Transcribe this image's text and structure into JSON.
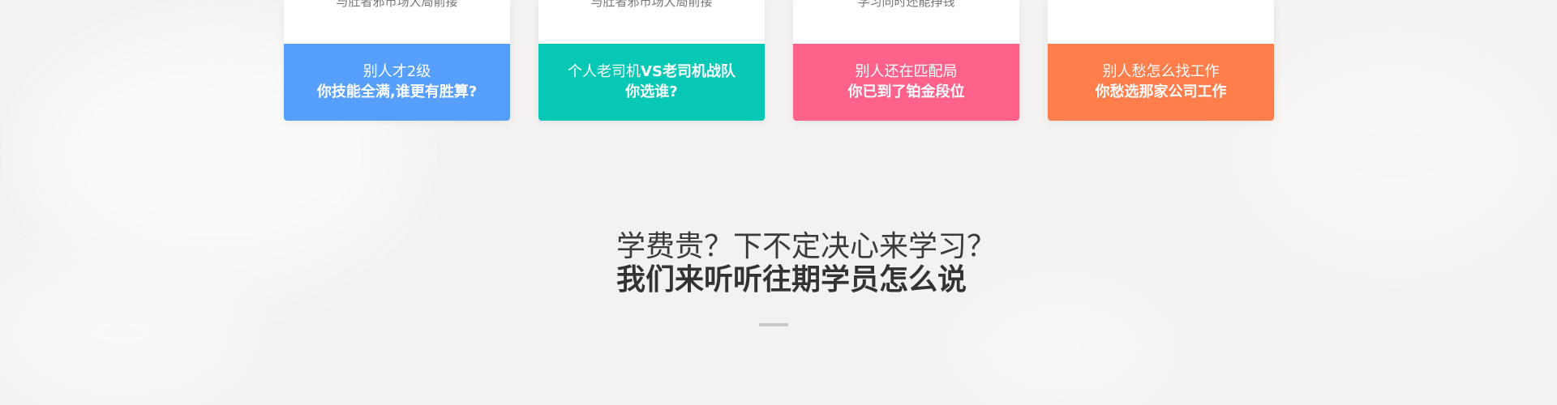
{
  "cards": [
    {
      "top_text": "与肚者邪市场大局前接",
      "line1": "别人才2级",
      "line2": "你技能全满,谁更有胜算?",
      "color": "#579ffd"
    },
    {
      "top_text": "与肚者邪市场大局前接",
      "line1_a": "个人老司机",
      "line1_b": "VS老司机战队",
      "line2": "你选谁?",
      "color": "#06c8b4"
    },
    {
      "top_text": "学习同时还能挣钱",
      "line1": "别人还在匹配局",
      "line2": "你已到了铂金段位",
      "color": "#fe6189"
    },
    {
      "top_text": "",
      "line1": "别人愁怎么找工作",
      "line2": "你愁选那家公司工作",
      "color": "#ff7e4c"
    }
  ],
  "section": {
    "heading_line1": "学费贵？下不定决心来学习？",
    "heading_line2": "我们来听听往期学员怎么说"
  }
}
